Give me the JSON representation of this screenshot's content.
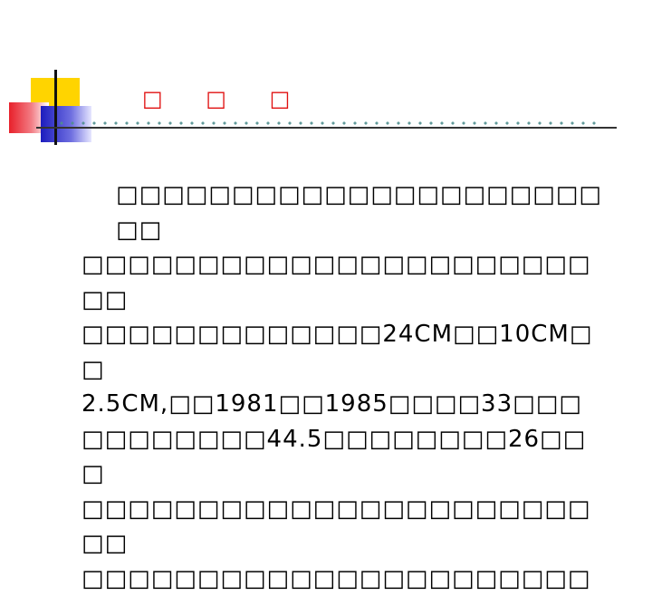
{
  "slide": {
    "title": "□ □ □",
    "body_lines": [
      "□□□□□□□□□□□□□□□□□□□□□□□",
      "□□□□□□□□□□□□□□□□□□□□□□□□",
      "□□□□□□□□□□□□□24CM□□10CM□□",
      "2.5CM,□□1981□□1985□□□□33□□□",
      "□□□□□□□□44.5□□□□□□□□26□□□",
      "□□□□□□□□□□□□□□□□□□□□□□□□",
      "□□□□□□□□□□□□□□□□□□□□□□"
    ]
  },
  "colors": {
    "title": "#e01010",
    "text": "#000000",
    "accent_yellow": "#ffd400",
    "accent_red": "#e8202a",
    "accent_blue": "#1c1cbe"
  }
}
